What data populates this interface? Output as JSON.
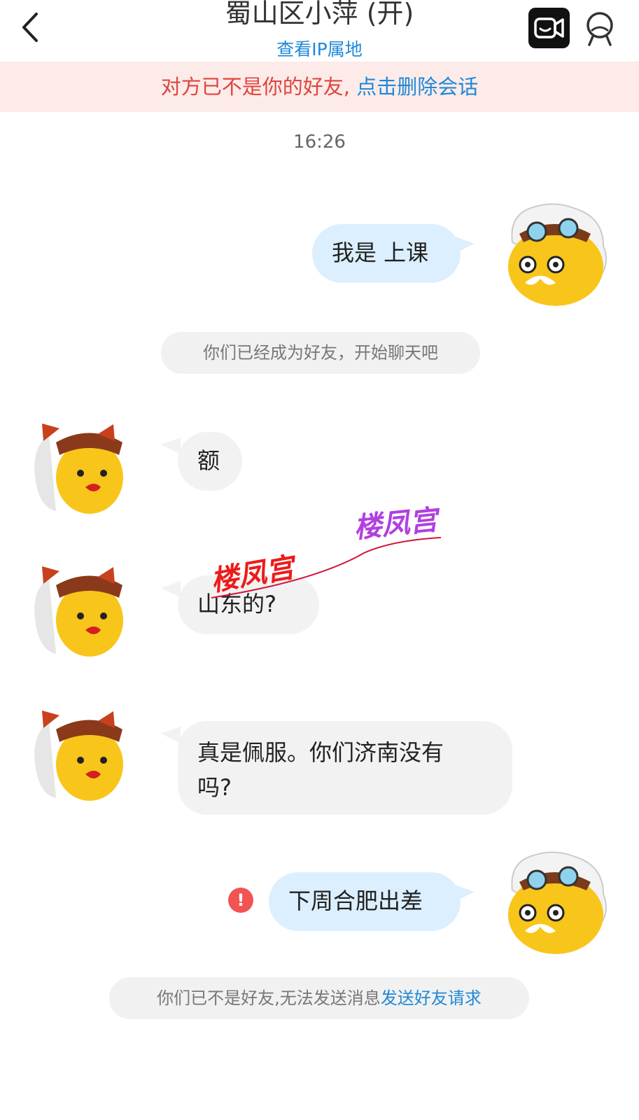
{
  "header": {
    "title": "蜀山区小萍 (开)",
    "subtitle": "查看IP属地"
  },
  "banner": {
    "warning": "对方已不是你的好友,",
    "action": "点击删除会话"
  },
  "chat": {
    "time": "16:26",
    "msg1": "我是 上课",
    "system1": "你们已经成为好友，开始聊天吧",
    "msg2": "额",
    "msg3": "山东的?",
    "msg4_line1": "真是佩服。你们济南没有",
    "msg4_line2": "吗?",
    "msg5": "下周合肥出差",
    "error_mark": "!",
    "system2_text": "你们已不是好友,无法发送消息",
    "system2_link": "发送好友请求"
  },
  "watermarks": [
    "楼凤宫",
    "楼凤宫"
  ],
  "colors": {
    "link_blue": "#1f88d8",
    "warning_red": "#e0443d",
    "outgoing_bubble": "#dcefff",
    "incoming_bubble": "#f2f2f2",
    "banner_bg": "#fcebe9"
  },
  "icons": {
    "back": "chevron-left-icon",
    "video": "video-call-icon",
    "profile": "person-icon"
  }
}
